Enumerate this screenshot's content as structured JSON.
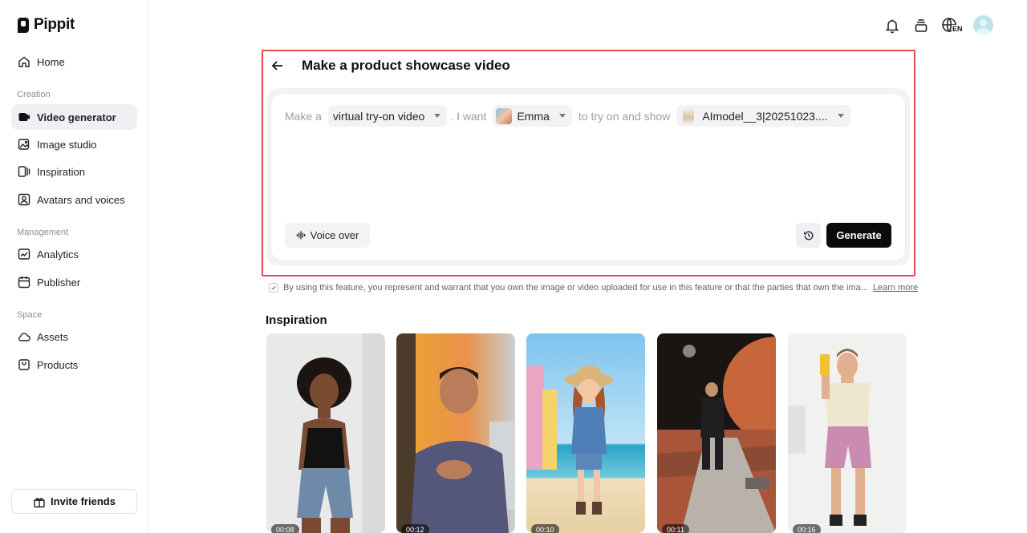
{
  "app": {
    "name": "Pippit"
  },
  "sidebar": {
    "home": "Home",
    "section_creation": "Creation",
    "creation_items": [
      "Video generator",
      "Image studio",
      "Inspiration",
      "Avatars and voices"
    ],
    "section_management": "Management",
    "management_items": [
      "Analytics",
      "Publisher"
    ],
    "section_space": "Space",
    "space_items": [
      "Assets",
      "Products"
    ],
    "invite": "Invite friends"
  },
  "topbar": {
    "language": "EN"
  },
  "main": {
    "title": "Make a product showcase video",
    "prompt": {
      "make_a": "Make a",
      "video_type": "virtual try-on video",
      "i_want": ". I want",
      "avatar": "Emma",
      "to_try": "to try on and show",
      "product": "AImodel__3|20251023...."
    },
    "voice_over": "Voice over",
    "generate": "Generate",
    "terms_text": "By using this feature, you represent and warrant that you own the image or video uploaded for use in this feature or that the parties that own the ima...",
    "learn_more": "Learn more",
    "inspiration_title": "Inspiration",
    "thumbnails": [
      {
        "badge": "00:08"
      },
      {
        "badge": "00:12"
      },
      {
        "badge": "00:10"
      },
      {
        "badge": "00:11"
      },
      {
        "badge": "00:16"
      }
    ]
  },
  "colors": {
    "accent_border": "#e24b4b",
    "active_nav": "#eef0f4",
    "generate_bg": "#0b0b0b"
  }
}
